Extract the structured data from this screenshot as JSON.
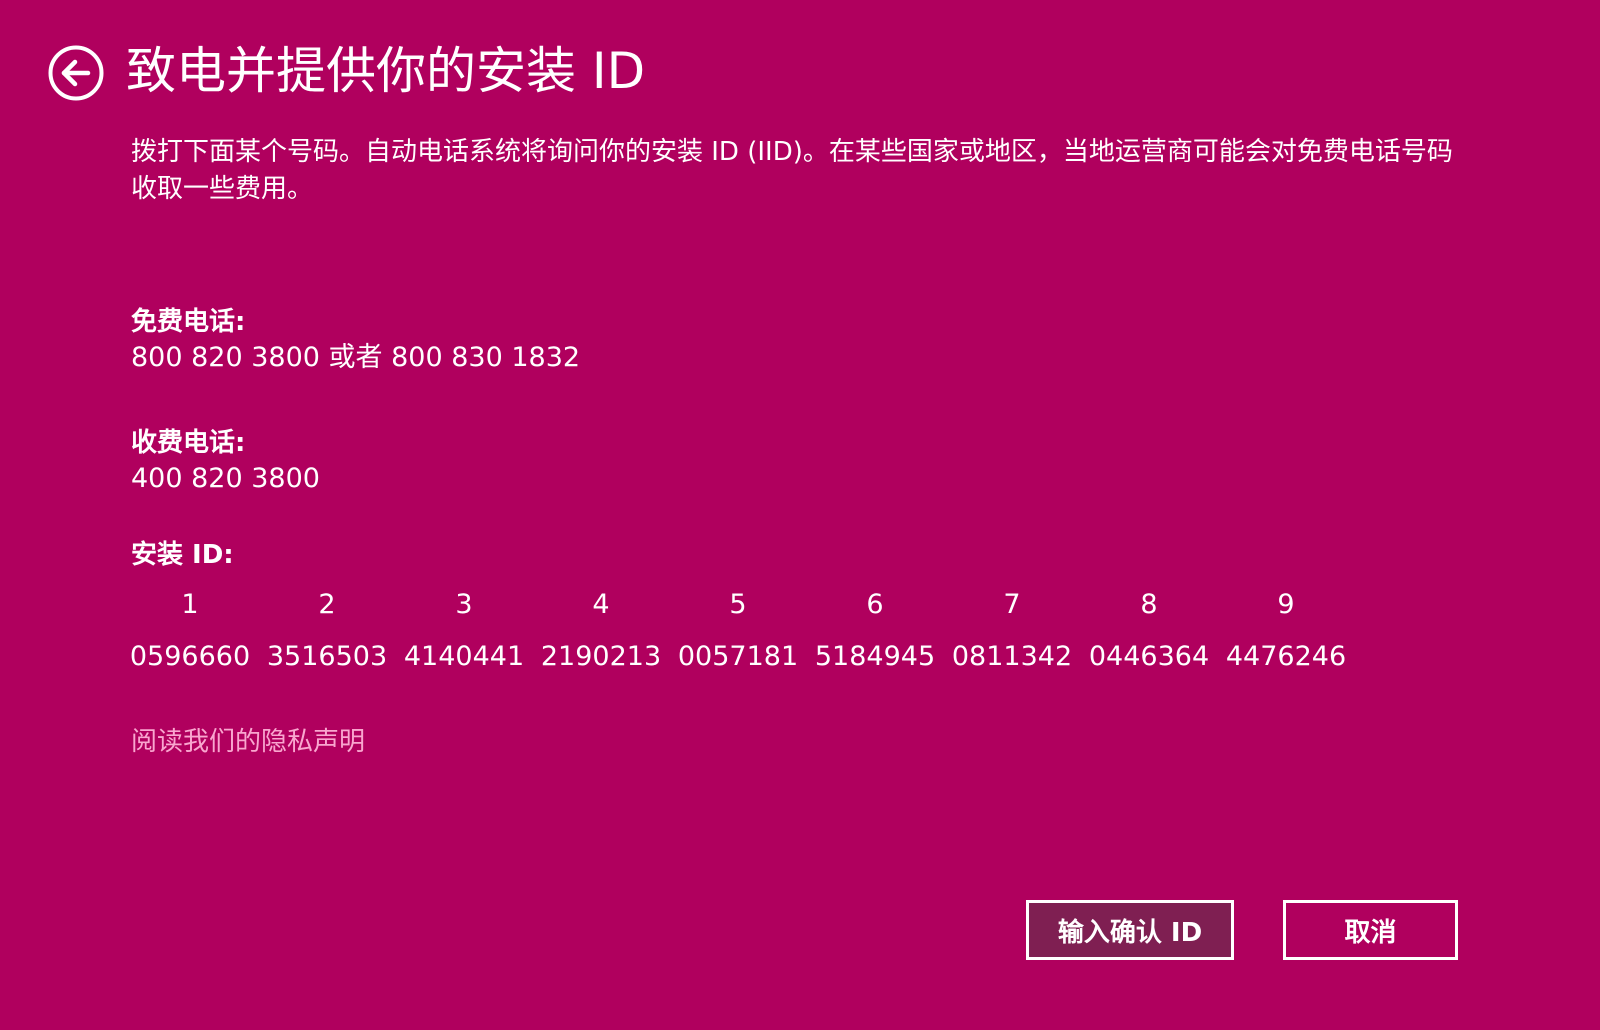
{
  "header": {
    "title": "致电并提供你的安装 ID",
    "back_icon": "back-arrow-circle-icon"
  },
  "description": "拨打下面某个号码。自动电话系统将询问你的安装 ID (IID)。在某些国家或地区，当地运营商可能会对免费电话号码收取一些费用。",
  "toll_free": {
    "label": "免费电话:",
    "value": "800 820 3800 或者 800 830 1832"
  },
  "toll": {
    "label": "收费电话:",
    "value": "400 820 3800"
  },
  "installation_id": {
    "label": "安装 ID:",
    "groups": [
      {
        "index": "1",
        "value": "0596660"
      },
      {
        "index": "2",
        "value": "3516503"
      },
      {
        "index": "3",
        "value": "4140441"
      },
      {
        "index": "4",
        "value": "2190213"
      },
      {
        "index": "5",
        "value": "0057181"
      },
      {
        "index": "6",
        "value": "5184945"
      },
      {
        "index": "7",
        "value": "0811342"
      },
      {
        "index": "8",
        "value": "0446364"
      },
      {
        "index": "9",
        "value": "4476246"
      }
    ]
  },
  "privacy_link": "阅读我们的隐私声明",
  "buttons": {
    "enter_confirmation": "输入确认 ID",
    "cancel": "取消"
  },
  "colors": {
    "background": "#b0005e",
    "primary_button": "#7f1f52",
    "link": "#f9a6cf",
    "text": "#ffffff"
  }
}
